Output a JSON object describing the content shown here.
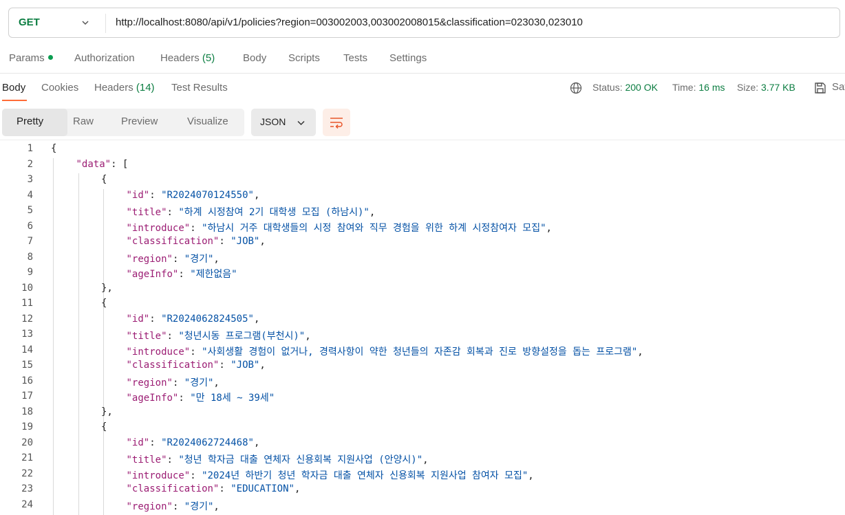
{
  "request": {
    "method": "GET",
    "url": "http://localhost:8080/api/v1/policies?region=003002003,003002008015&classification=023030,023010"
  },
  "request_tabs": [
    {
      "label": "Params",
      "dot": true
    },
    {
      "label": "Authorization"
    },
    {
      "label": "Headers",
      "count": "(5)"
    },
    {
      "label": "Body"
    },
    {
      "label": "Scripts"
    },
    {
      "label": "Tests"
    },
    {
      "label": "Settings"
    }
  ],
  "response_tabs": [
    {
      "label": "Body"
    },
    {
      "label": "Cookies"
    },
    {
      "label": "Headers",
      "count": "(14)"
    },
    {
      "label": "Test Results"
    }
  ],
  "status": {
    "status_label": "Status:",
    "status_value": "200 OK",
    "time_label": "Time:",
    "time_value": "16 ms",
    "size_label": "Size:",
    "size_value": "3.77 KB",
    "save_label": "Save"
  },
  "view_modes": [
    "Pretty",
    "Raw",
    "Preview",
    "Visualize"
  ],
  "format": "JSON",
  "code_lines": [
    {
      "n": "1",
      "indent": 0,
      "text": "{"
    },
    {
      "n": "2",
      "indent": 1,
      "key": "\"data\"",
      "rest": ": ["
    },
    {
      "n": "3",
      "indent": 2,
      "text": "{"
    },
    {
      "n": "4",
      "indent": 3,
      "key": "\"id\"",
      "val": "\"R2024070124550\"",
      "end": ","
    },
    {
      "n": "5",
      "indent": 3,
      "key": "\"title\"",
      "val": "\"하계 시정참여 2기 대학생 모집 (하남시)\"",
      "end": ","
    },
    {
      "n": "6",
      "indent": 3,
      "key": "\"introduce\"",
      "val": "\"하남시 거주 대학생들의 시정 참여와 직무 경험을 위한 하계 시정참여자 모집\"",
      "end": ","
    },
    {
      "n": "7",
      "indent": 3,
      "key": "\"classification\"",
      "val": "\"JOB\"",
      "end": ","
    },
    {
      "n": "8",
      "indent": 3,
      "key": "\"region\"",
      "val": "\"경기\"",
      "end": ","
    },
    {
      "n": "9",
      "indent": 3,
      "key": "\"ageInfo\"",
      "val": "\"제한없음\"",
      "end": ""
    },
    {
      "n": "10",
      "indent": 2,
      "text": "},"
    },
    {
      "n": "11",
      "indent": 2,
      "text": "{"
    },
    {
      "n": "12",
      "indent": 3,
      "key": "\"id\"",
      "val": "\"R2024062824505\"",
      "end": ","
    },
    {
      "n": "13",
      "indent": 3,
      "key": "\"title\"",
      "val": "\"청년시동 프로그램(부천시)\"",
      "end": ","
    },
    {
      "n": "14",
      "indent": 3,
      "key": "\"introduce\"",
      "val": "\"사회생활 경험이 없거나, 경력사항이 약한 청년들의 자존감 회복과 진로 방향설정을 돕는 프로그램\"",
      "end": ","
    },
    {
      "n": "15",
      "indent": 3,
      "key": "\"classification\"",
      "val": "\"JOB\"",
      "end": ","
    },
    {
      "n": "16",
      "indent": 3,
      "key": "\"region\"",
      "val": "\"경기\"",
      "end": ","
    },
    {
      "n": "17",
      "indent": 3,
      "key": "\"ageInfo\"",
      "val": "\"만 18세 ~ 39세\"",
      "end": ""
    },
    {
      "n": "18",
      "indent": 2,
      "text": "},"
    },
    {
      "n": "19",
      "indent": 2,
      "text": "{"
    },
    {
      "n": "20",
      "indent": 3,
      "key": "\"id\"",
      "val": "\"R2024062724468\"",
      "end": ","
    },
    {
      "n": "21",
      "indent": 3,
      "key": "\"title\"",
      "val": "\"청년 학자금 대출 연체자 신용회복 지원사업 (안양시)\"",
      "end": ","
    },
    {
      "n": "22",
      "indent": 3,
      "key": "\"introduce\"",
      "val": "\"2024년 하반기 청년 학자금 대출 연체자 신용회복 지원사업 참여자 모집\"",
      "end": ","
    },
    {
      "n": "23",
      "indent": 3,
      "key": "\"classification\"",
      "val": "\"EDUCATION\"",
      "end": ","
    },
    {
      "n": "24",
      "indent": 3,
      "key": "\"region\"",
      "val": "\"경기\"",
      "end": ","
    }
  ]
}
